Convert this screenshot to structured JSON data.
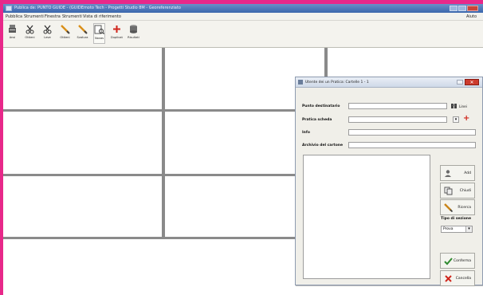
{
  "window": {
    "title": "Publica de: PUNTO GUIDE - (GUIDEmoto Tech - Progetti Studio 8M - Georeferenziato"
  },
  "menubar": {
    "items": [
      "Pubblica",
      "Strumenti",
      "Finestra",
      "Strumenti",
      "Vista di riferimento"
    ],
    "help": "Aiuto"
  },
  "toolbar": {
    "tools": [
      {
        "label": "Ansi",
        "icon": "server-icon"
      },
      {
        "label": "Ottieni",
        "icon": "scissors-icon"
      },
      {
        "label": "Leve",
        "icon": "scissors-icon"
      },
      {
        "label": "Ottieni",
        "icon": "pencil-icon"
      },
      {
        "label": "Svatura",
        "icon": "pencil-icon"
      },
      {
        "label": "Novas",
        "icon": "document-search-icon"
      },
      {
        "label": "Duplicato",
        "icon": "plus-icon"
      },
      {
        "label": "Risultati",
        "icon": "database-icon"
      }
    ]
  },
  "dialog": {
    "title": "Utente dei un Pratica: Cartelle 1 - 1",
    "close_glyph": "✕",
    "fields": {
      "punto_label": "Punto destinatario",
      "punto_value": "",
      "punto_side": "Linei",
      "pratica_label": "Pratica scheda",
      "pratica_value": "",
      "info_label": "Info",
      "info_value": "",
      "archivio_label": "Archivio del cartone",
      "archivio_value": ""
    },
    "side_buttons": {
      "add": "Add",
      "chiudi": "Chiudi",
      "ricerca": "Ricerca",
      "conferma": "Conferma",
      "cancella": "Cancella"
    },
    "tipo_label": "Tipo di sezione",
    "tipo_value": "Prova"
  },
  "colors": {
    "background": "#e8288a",
    "titlebar": "#3a66ad",
    "grid_lines": "#8a8a8a",
    "dialog_close": "#cc3b2e"
  }
}
